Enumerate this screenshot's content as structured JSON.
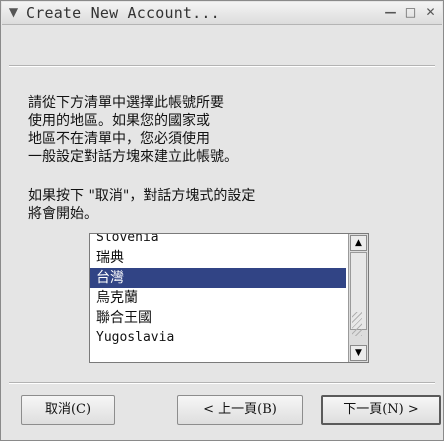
{
  "window": {
    "title": "Create New Account...",
    "menu_icon": "chevron-down-icon",
    "minimize_icon": "minimize-icon",
    "maximize_icon": "maximize-icon",
    "close_icon": "close-icon"
  },
  "description": "請從下方清單中選擇此帳號所要\n使用的地區。如果您的國家或\n地區不在清單中，您必須使用\n一般設定對話方塊來建立此帳號。",
  "note": "如果按下 \"取消\"，對話方塊式的設定\n將會開始。",
  "region_list": {
    "items": [
      "Slovenia",
      "瑞典",
      "台灣",
      "烏克蘭",
      "聯合王國",
      "Yugoslavia"
    ],
    "selected_index": 2
  },
  "buttons": {
    "cancel": "取消(C)",
    "back": "< 上一頁(B)",
    "next": "下一頁(N) >"
  }
}
